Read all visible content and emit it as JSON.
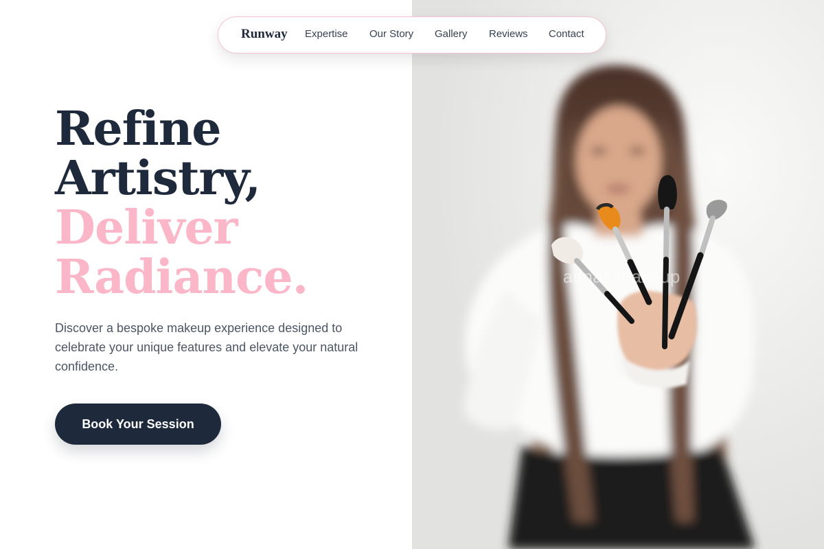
{
  "nav": {
    "brand": "Runway",
    "links": [
      "Expertise",
      "Our Story",
      "Gallery",
      "Reviews",
      "Contact"
    ]
  },
  "hero": {
    "headline_dark": [
      "Refine",
      "Artistry,"
    ],
    "headline_accent": [
      "Deliver",
      "Radiance."
    ],
    "subtext": "Discover a bespoke makeup experience designed to celebrate your unique features and elevate your natural confidence.",
    "cta_label": "Book Your Session"
  },
  "image": {
    "watermark": "aunas makeup",
    "description_icon": "portrait-photo"
  },
  "colors": {
    "dark": "#1e293b",
    "accent_pink": "#fbb6c8",
    "body_text": "#4b5563",
    "nav_border": "#f4c3d1"
  }
}
